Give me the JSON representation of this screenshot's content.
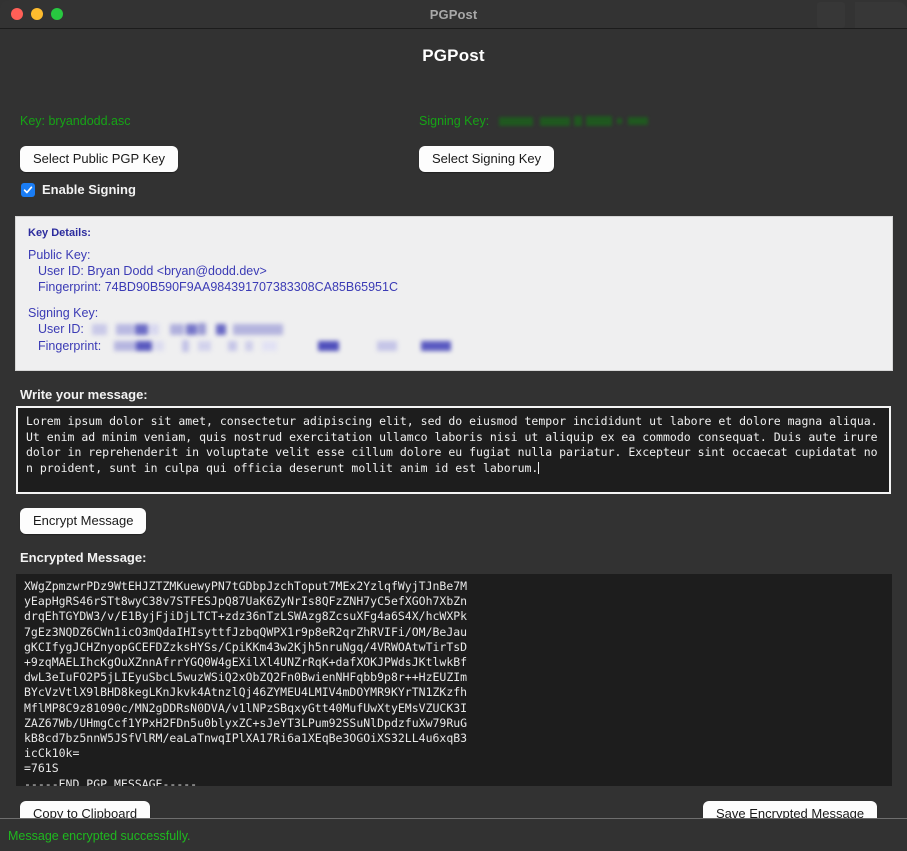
{
  "window": {
    "title": "PGPost",
    "traffic_lights": [
      "close",
      "minimize",
      "maximize"
    ]
  },
  "header": {
    "app_title": "PGPost"
  },
  "keys": {
    "public_key_label": "Key: bryandodd.asc",
    "signing_key_label": "Signing Key:",
    "signing_key_value_redacted": true,
    "select_public_button": "Select Public PGP Key",
    "select_signing_button": "Select Signing Key",
    "enable_signing_label": "Enable Signing",
    "enable_signing_checked": true
  },
  "key_details": {
    "heading": "Key Details:",
    "public_key_heading": "Public Key:",
    "public_user_id": "User ID: Bryan Dodd <bryan@dodd.dev>",
    "public_fingerprint": "Fingerprint: 74BD90B590F9AA984391707383308CA85B65951C",
    "signing_key_heading": "Signing Key:",
    "signing_user_id_label": "User ID:",
    "signing_user_id_redacted": true,
    "signing_fingerprint_label": "Fingerprint:",
    "signing_fingerprint_redacted": true
  },
  "message": {
    "label": "Write your message:",
    "value": "Lorem ipsum dolor sit amet, consectetur adipiscing elit, sed do eiusmod tempor incididunt ut labore et dolore magna aliqua. Ut enim ad minim veniam, quis nostrud exercitation ullamco laboris nisi ut aliquip ex ea commodo consequat. Duis aute irure dolor in reprehenderit in voluptate velit esse cillum dolore eu fugiat nulla pariatur. Excepteur sint occaecat cupidatat non proident, sunt in culpa qui officia deserunt mollit anim id est laborum.",
    "placeholder": "",
    "encrypt_button": "Encrypt Message"
  },
  "encrypted": {
    "label": "Encrypted Message:",
    "value": "XWgZpmzwrPDz9WtEHJZTZMKuewyPN7tGDbpJzchToput7MEx2YzlqfWyjTJnBe7M\nyEapHgRS46rSTt8wyC38v7STFESJpQ87UaK6ZyNrIs8QFzZNH7yC5efXGOh7XbZn\ndrqEhTGYDW3/v/E1ByjFjiDjLTCT+zdz36nTzLSWAzg8ZcsuXFg4a6S4X/hcWXPk\n7gEz3NQDZ6CWn1icO3mQdaIHIsyttfJzbqQWPX1r9p8eR2qrZhRVIFi/OM/BeJau\ngKCIfygJCHZnyopGCEFDZzksHYSs/CpiKKm43w2Kjh5nruNgq/4VRWOAtwTirTsD\n+9zqMAELIhcKgOuXZnnAfrrYGQ0W4gEXilXl4UNZrRqK+dafXOKJPWdsJKtlwkBf\ndwL3eIuFO2P5jLIEyuSbcL5wuzWSiQ2xObZQ2Fn0BwienNHFqbb9p8r++HzEUZIm\nBYcVzVtlX9lBHD8kegLKnJkvk4AtnzlQj46ZYMEU4LMIV4mDOYMR9KYrTN1ZKzfh\nMflMP8C9z81090c/MN2gDDRsN0DVA/v1lNPzSBqxyGtt40MufUwXtyEMsVZUCK3I\nZAZ67Wb/UHmgCcf1YPxH2FDn5u0blyxZC+sJeYT3LPum92SSuNlDpdzfuXw79RuG\nkB8cd7bz5nnW5JSfVlRM/eaLaTnwqIPlXA17Ri6a1XEqBe3OGOiXS32LL4u6xqB3\nicCk10k=\n=761S\n-----END PGP MESSAGE-----",
    "copy_button": "Copy to Clipboard",
    "save_button": "Save Encrypted Message"
  },
  "status": {
    "message": "Message encrypted successfully."
  },
  "colors": {
    "window_bg": "#323232",
    "accent_green": "#16a416",
    "status_green": "#1fb81f",
    "details_text": "#3b3bb5",
    "details_bg": "#efeff0",
    "checkbox_blue": "#1a7df5",
    "code_bg": "#1d1d1d"
  }
}
